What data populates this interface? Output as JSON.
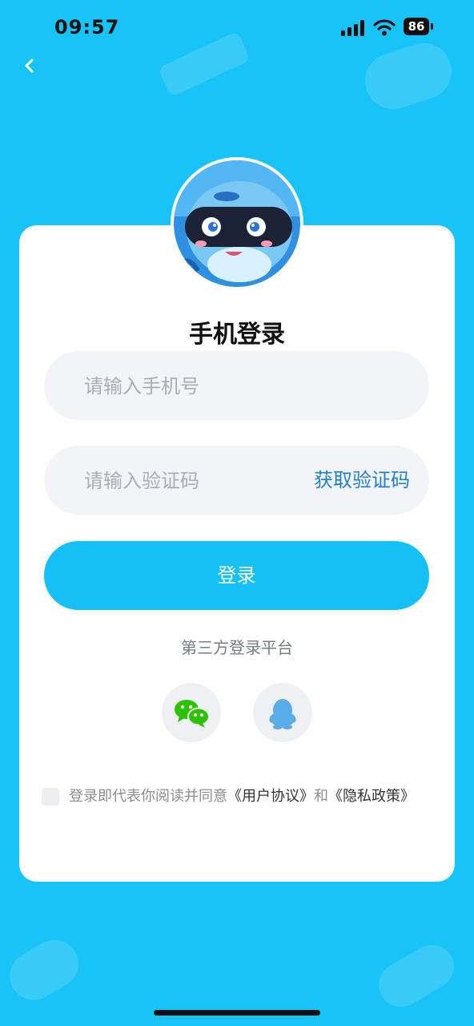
{
  "status_bar": {
    "time": "09:57",
    "battery": "86"
  },
  "login": {
    "title": "手机登录",
    "phone_placeholder": "请输入手机号",
    "code_placeholder": "请输入验证码",
    "get_code_label": "获取验证码",
    "submit_label": "登录",
    "third_party_label": "第三方登录平台"
  },
  "agreement": {
    "prefix": "登录即代表你阅读并同意",
    "user_agreement": "《用户协议》",
    "conjunction": "和",
    "privacy_policy": "《隐私政策》"
  },
  "colors": {
    "background": "#18c3f7",
    "button": "#14c0f5",
    "link": "#1f7fd0",
    "wechat": "#2dc100",
    "qq": "#5aaee8"
  },
  "icons": [
    "back-icon",
    "signal-icon",
    "wifi-icon",
    "battery-icon",
    "wechat-icon",
    "qq-icon"
  ]
}
